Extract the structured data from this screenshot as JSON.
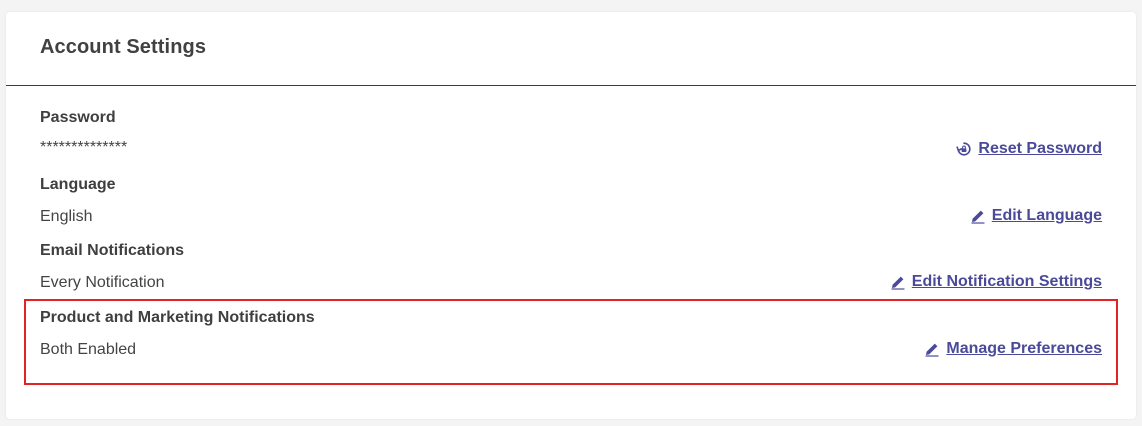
{
  "header": {
    "title": "Account Settings"
  },
  "settings": [
    {
      "label": "Password",
      "value": "**************",
      "action_label": "Reset Password",
      "action_icon": "reset-password-icon"
    },
    {
      "label": "Language",
      "value": "English",
      "action_label": "Edit Language",
      "action_icon": "pencil-icon"
    },
    {
      "label": "Email Notifications",
      "value": "Every Notification",
      "action_label": "Edit Notification Settings",
      "action_icon": "pencil-icon"
    },
    {
      "label": "Product and Marketing Notifications",
      "value": "Both Enabled",
      "action_label": "Manage Preferences",
      "action_icon": "pencil-icon"
    }
  ],
  "colors": {
    "link": "#4b4a9a",
    "highlight": "#e02424",
    "divider": "#3d3d3d"
  }
}
